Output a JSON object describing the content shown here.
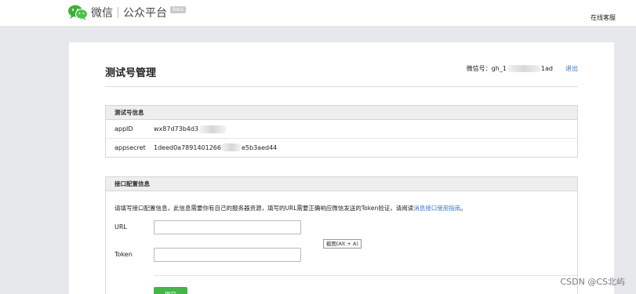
{
  "header": {
    "brand": "微信",
    "product": "公众平台",
    "beta": "Beta",
    "help": "在线客服"
  },
  "page": {
    "title": "测试号管理",
    "account_label": "微信号：gh_1",
    "account_suffix": "1ad",
    "logout": "退出"
  },
  "test_info": {
    "heading": "测试号信息",
    "rows": [
      {
        "key": "appID",
        "value_prefix": "wx87d73b4d3",
        "value_suffix": ""
      },
      {
        "key": "appsecret",
        "value_prefix": "1deed0a7891401266",
        "value_suffix": "e5b3aed44"
      }
    ]
  },
  "api_config": {
    "heading": "接口配置信息",
    "desc_prefix": "请填写接口配置信息，此信息需要你有自己的服务器资源，填写的URL需要正确响应微信发送的Token验证，请阅读",
    "desc_link": "消息接口使用指南",
    "desc_suffix": "。",
    "url_label": "URL",
    "url_value": "",
    "token_label": "Token",
    "token_value": "",
    "tooltip": "截图(Alt + A)",
    "submit": "提交"
  },
  "watermark": "CSDN @CS北屿",
  "colors": {
    "accent_green": "#44b549",
    "link_blue": "#3a79c9",
    "page_bg": "#e7e8eb"
  }
}
